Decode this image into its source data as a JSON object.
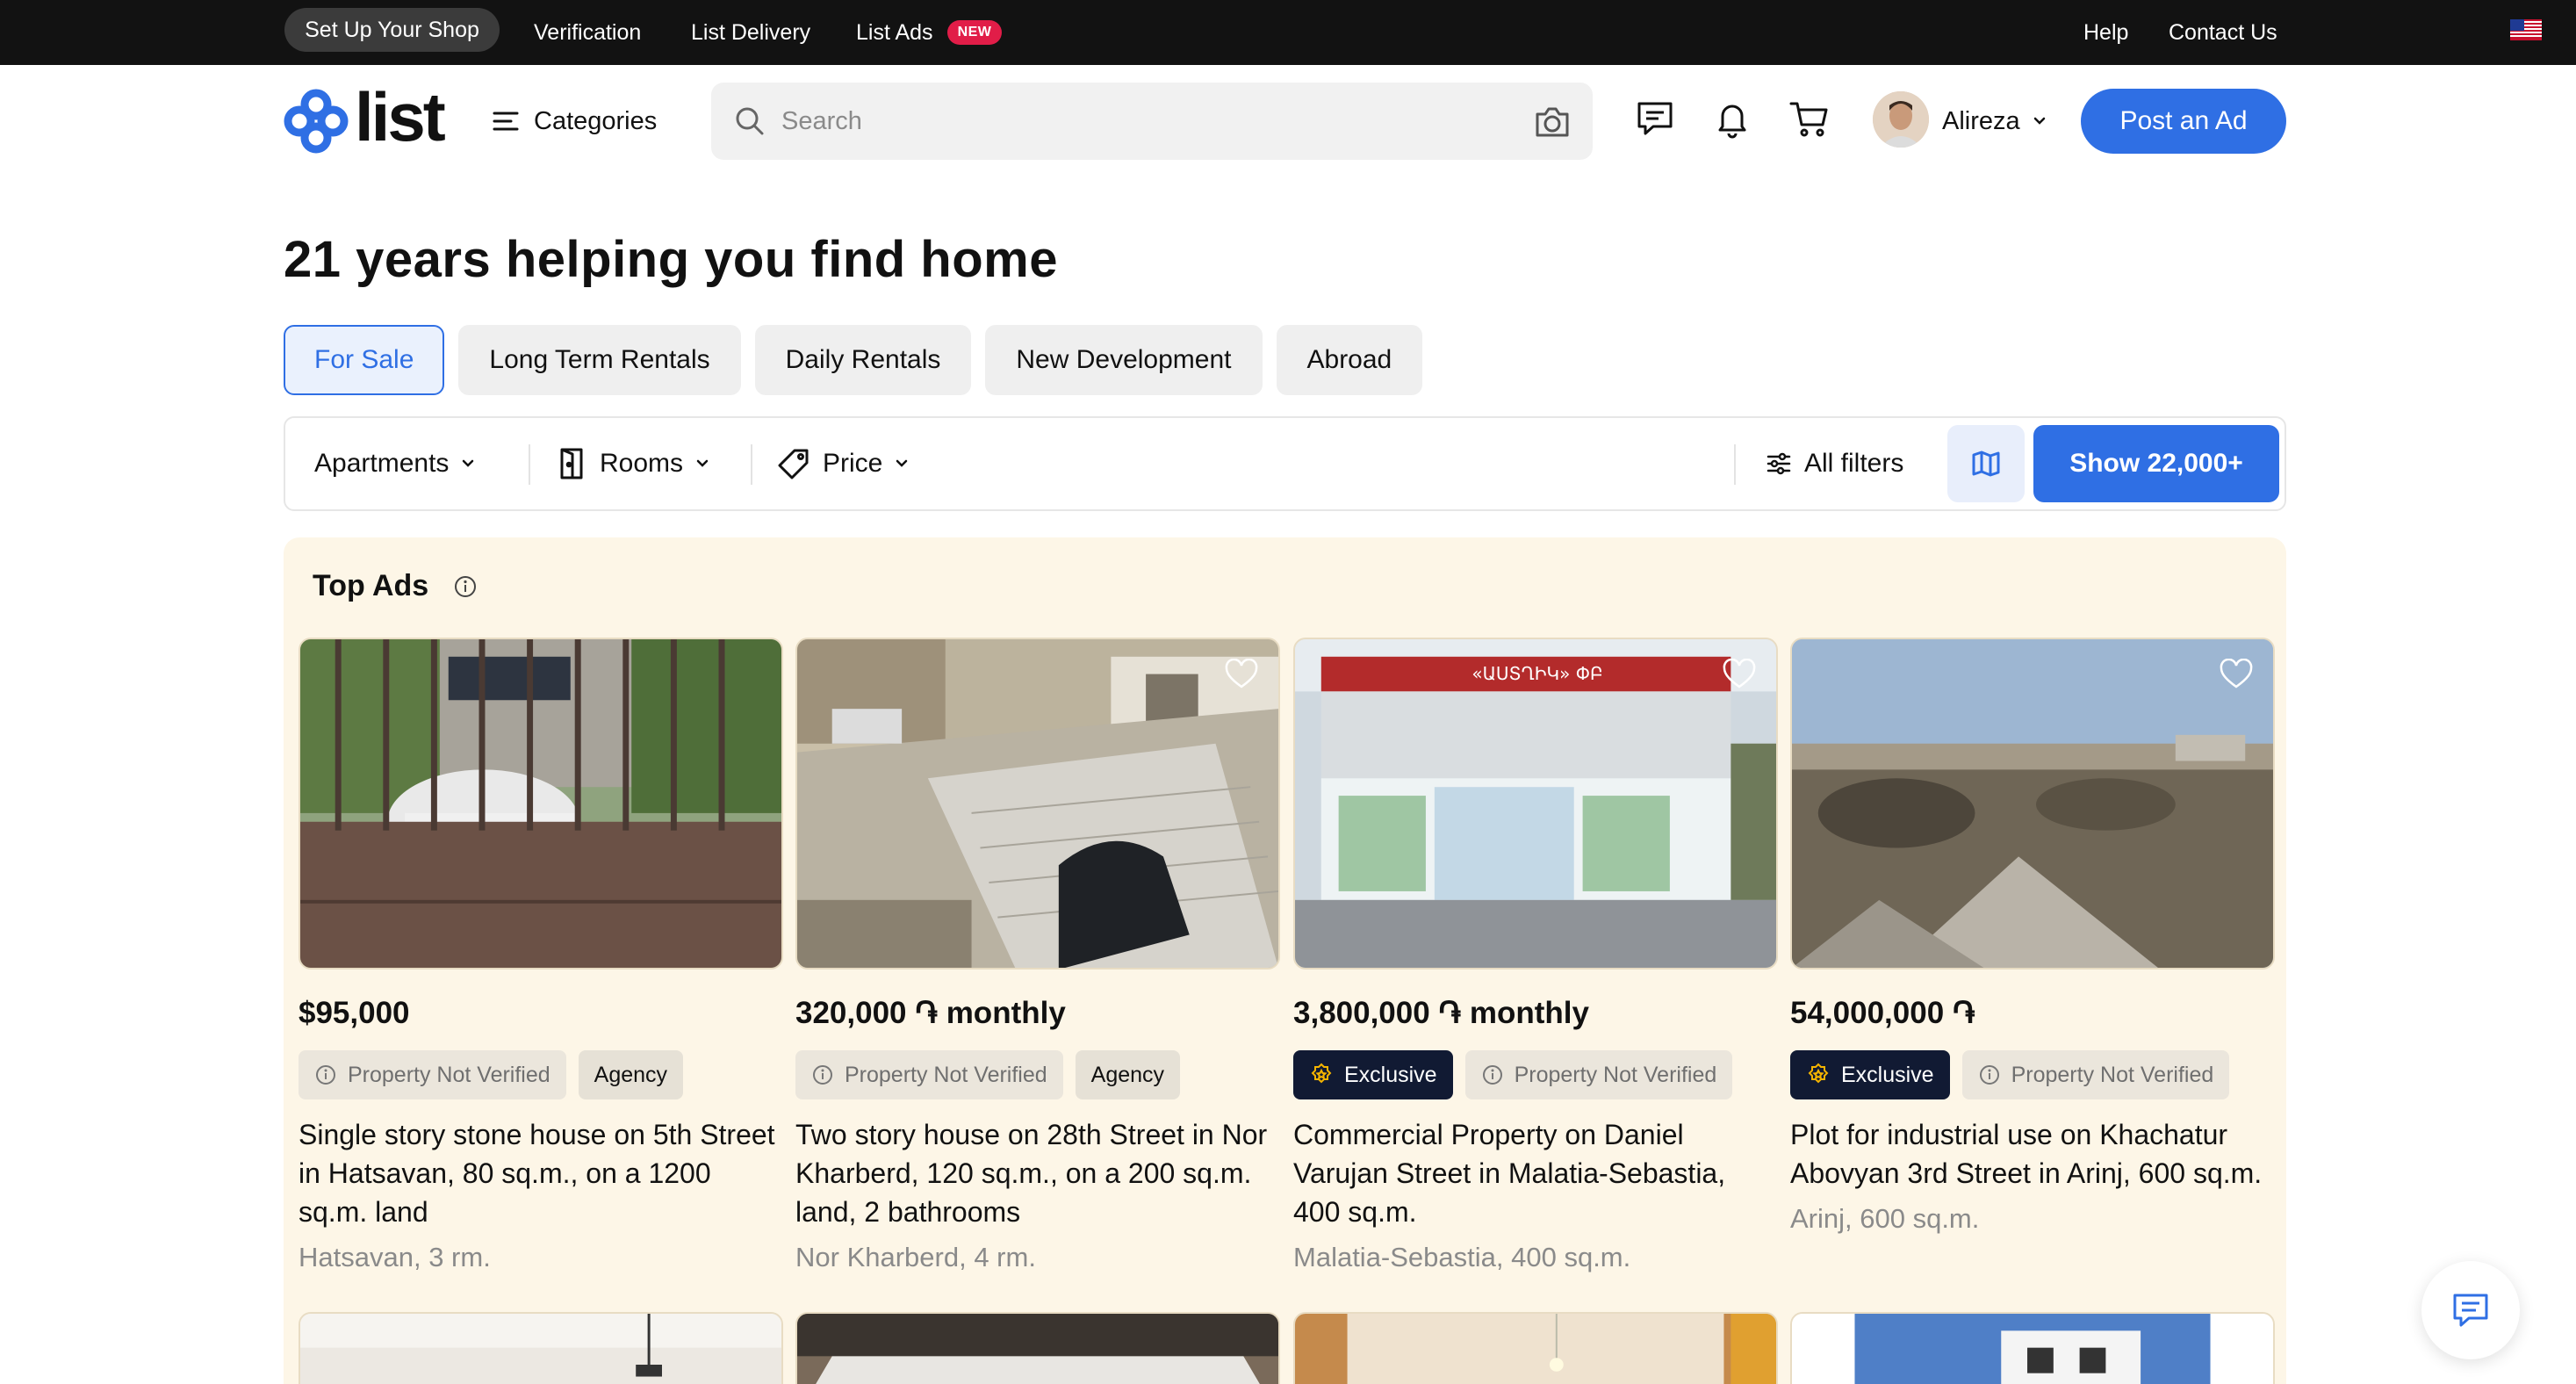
{
  "topbar": {
    "shop_label": "Set Up Your Shop",
    "verification": "Verification",
    "list_delivery": "List Delivery",
    "list_ads": "List Ads",
    "new_badge": "NEW",
    "help": "Help",
    "contact": "Contact Us",
    "flag_icon": "us-flag-icon"
  },
  "header": {
    "logo_text": "list",
    "categories_label": "Categories",
    "search_placeholder": "Search",
    "user_name": "Alireza",
    "post_ad_label": "Post an Ad",
    "icons": [
      "menu-icon",
      "search-icon",
      "camera-icon",
      "messages-icon",
      "bell-icon",
      "cart-icon",
      "chevron-down-icon"
    ]
  },
  "hero": {
    "title": "21 years helping you find home",
    "tabs": [
      {
        "label": "For Sale",
        "active": true
      },
      {
        "label": "Long Term Rentals",
        "active": false
      },
      {
        "label": "Daily Rentals",
        "active": false
      },
      {
        "label": "New Development",
        "active": false
      },
      {
        "label": "Abroad",
        "active": false
      }
    ]
  },
  "filters": {
    "type_label": "Apartments",
    "rooms_label": "Rooms",
    "price_label": "Price",
    "all_filters_label": "All filters",
    "show_label": "Show 22,000+"
  },
  "top_ads": {
    "title": "Top Ads",
    "cards": [
      {
        "price": "$95,000",
        "badges": [
          {
            "type": "nv",
            "label": "Property Not Verified"
          },
          {
            "type": "ag",
            "label": "Agency"
          }
        ],
        "title": "Single story stone house on 5th Street in Hatsavan, 80 sq.m., on a 1200 sq.m. land",
        "location": "Hatsavan, 3 rm."
      },
      {
        "price": "320,000 ֏ monthly",
        "badges": [
          {
            "type": "nv",
            "label": "Property Not Verified"
          },
          {
            "type": "ag",
            "label": "Agency"
          }
        ],
        "title": "Two story house on 28th Street in Nor Kharberd, 120 sq.m., on a 200 sq.m. land, 2 bathrooms",
        "location": "Nor Kharberd, 4 rm."
      },
      {
        "price": "3,800,000 ֏ monthly",
        "badges": [
          {
            "type": "ex",
            "label": "Exclusive"
          },
          {
            "type": "nv",
            "label": "Property Not Verified"
          }
        ],
        "title": "Commercial Property on Daniel Varujan Street in Malatia-Sebastia, 400 sq.m.",
        "location": "Malatia-Sebastia, 400 sq.m.",
        "sign_text": "«ԱՍՏՂԻԿ» ՓԲ"
      },
      {
        "price": "54,000,000 ֏",
        "badges": [
          {
            "type": "ex",
            "label": "Exclusive"
          },
          {
            "type": "nv",
            "label": "Property Not Verified"
          }
        ],
        "title": "Plot for industrial use on Khachatur Abovyan 3rd Street in Arinj, 600 sq.m.",
        "location": "Arinj, 600 sq.m."
      }
    ]
  },
  "colors": {
    "brand_blue": "#2f6fe4",
    "topbar_bg": "#121212",
    "top_ads_bg": "#fdf6e7",
    "exclusive_bg": "#111a33",
    "new_badge": "#e11d48"
  }
}
